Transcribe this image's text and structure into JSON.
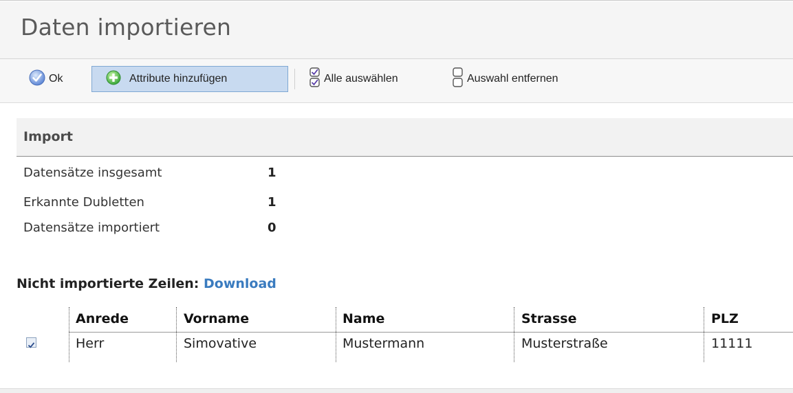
{
  "title": "Daten importieren",
  "toolbar": {
    "ok_label": "Ok",
    "attr_label": "Attribute hinzufügen",
    "select_all_label": "Alle auswählen",
    "deselect_label": "Auswahl entfernen"
  },
  "import": {
    "heading": "Import",
    "stats": [
      {
        "label": "Datensätze insgesamt",
        "value": "1"
      },
      {
        "label": "Erkannte Dubletten",
        "value": "1"
      },
      {
        "label": "Datensätze importiert",
        "value": "0"
      }
    ]
  },
  "not_imported": {
    "label": "Nicht importierte Zeilen:",
    "download": "Download"
  },
  "table": {
    "headers": [
      "Anrede",
      "Vorname",
      "Name",
      "Strasse",
      "PLZ"
    ],
    "rows": [
      {
        "checked": true,
        "cells": [
          "Herr",
          "Simovative",
          "Mustermann",
          "Musterstraße",
          "11111"
        ]
      }
    ]
  },
  "colors": {
    "accent": "#3a7bbf",
    "button_active_bg": "#c8daf0",
    "button_active_border": "#7fa7d3"
  }
}
